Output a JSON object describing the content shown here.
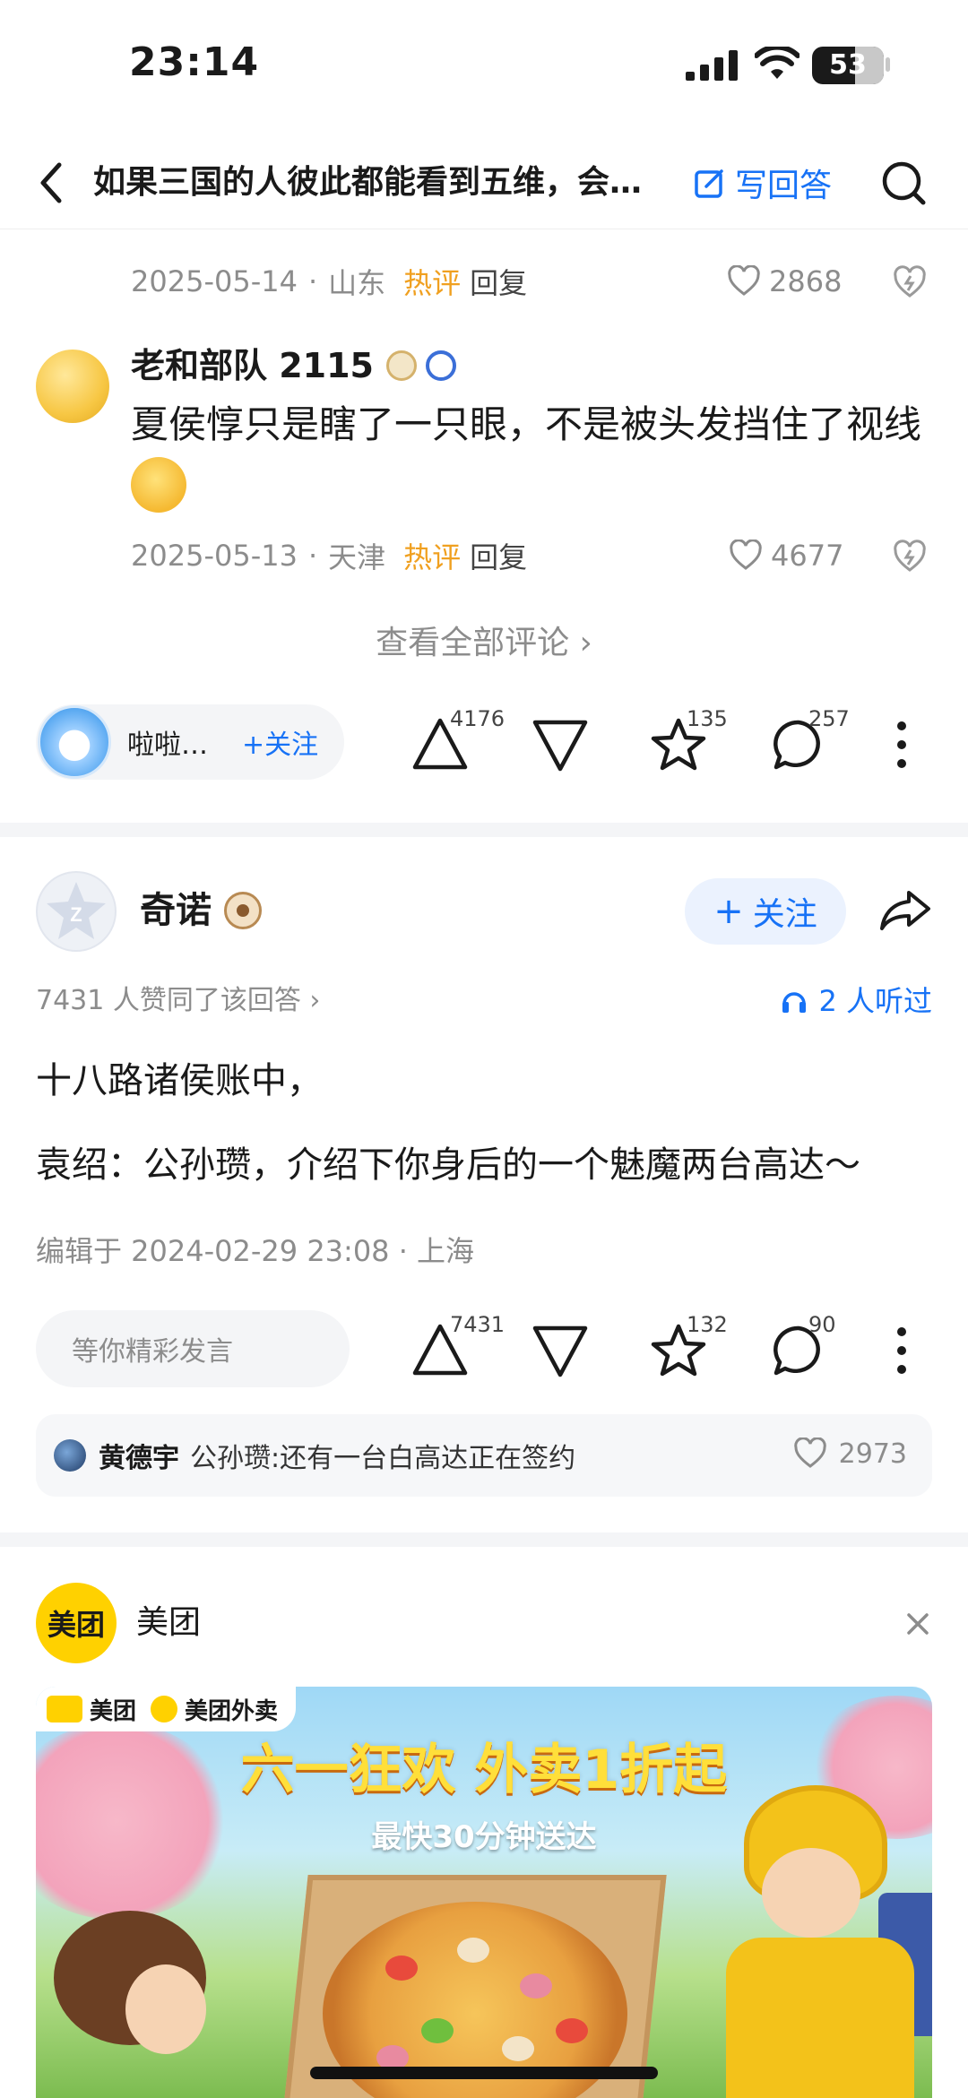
{
  "status_bar": {
    "time": "23:14",
    "battery": "53"
  },
  "header": {
    "title": "如果三国的人彼此都能看到五维，会…",
    "write_label": "写回答"
  },
  "comment1_meta": {
    "date": "2025-05-14",
    "location": "山东",
    "hot": "热评",
    "reply": "回复",
    "likes": "2868"
  },
  "comment2": {
    "name": "老和部队 2115",
    "text": "夏侯惇只是瞎了一只眼，不是被头发挡住了视线",
    "date": "2025-05-13",
    "location": "天津",
    "hot": "热评",
    "reply": "回复",
    "likes": "4677"
  },
  "view_all": "查看全部评论 ›",
  "action_bar_1": {
    "user": "啦啦…",
    "follow": "+关注",
    "upvotes": "4176",
    "favorites": "135",
    "comments": "257"
  },
  "answer": {
    "author": "奇诺",
    "follow": "关注",
    "agree_text": "7431 人赞同了该回答 ›",
    "listened": "2 人听过",
    "para1": "十八路诸侯账中，",
    "para2": "袁绍：公孙瓒，介绍下你身后的一个魅魔两台高达～",
    "edited": "编辑于 2024-02-29 23:08 · 上海",
    "input_placeholder": "等你精彩发言",
    "upvotes": "7431",
    "favorites": "132",
    "comments": "90",
    "top_comment": {
      "name": "黄德宇",
      "text": "公孙瓒:还有一台白高达正在签约",
      "likes": "2973"
    }
  },
  "ad": {
    "avatar_text": "美团",
    "name": "美团",
    "tag1": "美团",
    "tag2": "美团外卖",
    "headline": "六一狂欢 外卖1折起",
    "sub": "最快30分钟送达"
  },
  "colors": {
    "accent": "#1772f6",
    "hot": "#f0a020",
    "meituan": "#ffd100"
  }
}
